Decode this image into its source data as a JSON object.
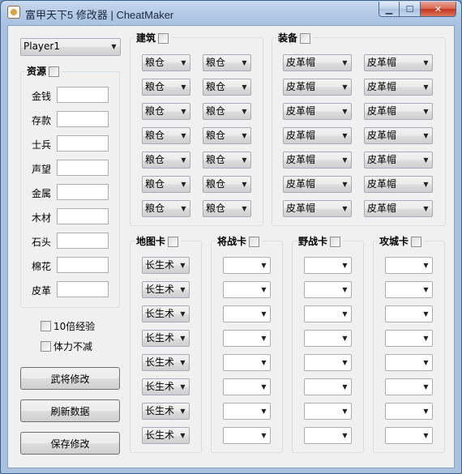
{
  "window": {
    "title": "富甲天下5 修改器 | CheatMaker"
  },
  "player_select": {
    "value": "Player1"
  },
  "resources": {
    "title": "资源",
    "labels": [
      "金钱",
      "存款",
      "士兵",
      "声望",
      "金属",
      "木材",
      "石头",
      "棉花",
      "皮革"
    ]
  },
  "options": {
    "exp10": "10倍经验",
    "stamina": "体力不减"
  },
  "buttons": {
    "general": "武将修改",
    "refresh": "刷新数据",
    "save": "保存修改"
  },
  "buildings": {
    "title": "建筑",
    "left": [
      "粮仓",
      "粮仓",
      "粮仓",
      "粮仓",
      "粮仓",
      "粮仓",
      "粮仓"
    ],
    "right": [
      "粮仓",
      "粮仓",
      "粮仓",
      "粮仓",
      "粮仓",
      "粮仓",
      "粮仓"
    ]
  },
  "equipment": {
    "title": "装备",
    "left": [
      "皮革帽",
      "皮革帽",
      "皮革帽",
      "皮革帽",
      "皮革帽",
      "皮革帽",
      "皮革帽"
    ],
    "right": [
      "皮革帽",
      "皮革帽",
      "皮革帽",
      "皮革帽",
      "皮革帽",
      "皮革帽",
      "皮革帽"
    ]
  },
  "map_cards": {
    "title": "地图卡",
    "values": [
      "长生术",
      "长生术",
      "长生术",
      "长生术",
      "长生术",
      "长生术",
      "长生术",
      "长生术"
    ]
  },
  "general_cards": {
    "title": "将战卡",
    "values": [
      "",
      "",
      "",
      "",
      "",
      "",
      "",
      ""
    ]
  },
  "field_cards": {
    "title": "野战卡",
    "values": [
      "",
      "",
      "",
      "",
      "",
      "",
      "",
      ""
    ]
  },
  "siege_cards": {
    "title": "攻城卡",
    "values": [
      "",
      "",
      "",
      "",
      "",
      "",
      "",
      ""
    ]
  },
  "icons": {
    "dropdown": "chevron-down-icon",
    "minimize": "minimize-icon",
    "maximize": "maximize-icon",
    "close": "close-icon"
  }
}
